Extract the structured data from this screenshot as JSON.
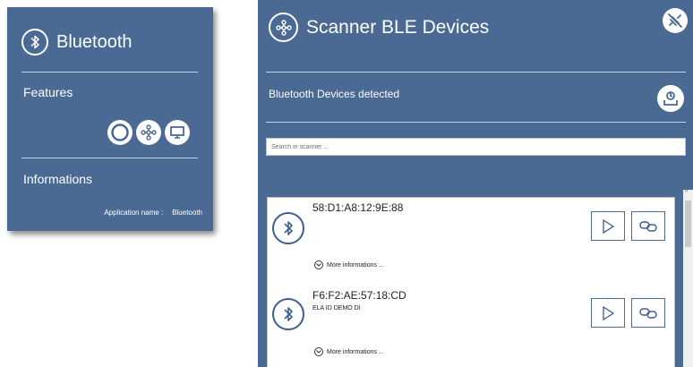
{
  "left_card": {
    "title": "Bluetooth",
    "features_label": "Features",
    "feature_icons": [
      "circle-icon",
      "network-icon",
      "monitor-icon"
    ],
    "informations_label": "Informations",
    "app_name_label": "Application name :",
    "app_name_value": "Bluetooth",
    "icon": "bluetooth-icon"
  },
  "panel": {
    "title": "Scanner BLE Devices",
    "title_icon": "network-icon",
    "top_right_icon": "disconnect-icon",
    "subtitle": "Bluetooth Devices detected",
    "refresh_icon": "refresh-icon",
    "search": {
      "placeholder": "Search in scanner ..."
    },
    "devices": [
      {
        "mac": "58:D1:A8:12:9E:88",
        "name": "",
        "more_label": "More informations ..."
      },
      {
        "mac": "F6:F2:AE:57:18:CD",
        "name": "ELA ID DEMO DI",
        "more_label": "More informations ..."
      }
    ]
  },
  "colors": {
    "panel_bg": "#4a6a93",
    "accent": "#3d5f8c"
  }
}
